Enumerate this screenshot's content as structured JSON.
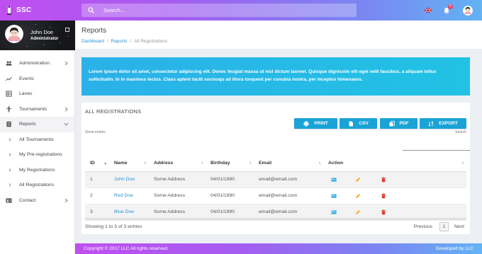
{
  "app": {
    "brand": "SSC"
  },
  "search": {
    "placeholder": "Search..."
  },
  "notifications": {
    "count": "5"
  },
  "user": {
    "name": "John Doe",
    "role": "Administrator"
  },
  "sidebar": {
    "items": [
      {
        "label": "Administration",
        "icon": "people-icon",
        "chevron": true
      },
      {
        "label": "Events",
        "icon": "trend-icon",
        "chevron": false
      },
      {
        "label": "Lanes",
        "icon": "table-icon",
        "chevron": false
      },
      {
        "label": "Tournaments",
        "icon": "person-icon",
        "chevron": true
      },
      {
        "label": "Reports",
        "icon": "report-icon",
        "chevron": true,
        "active": true
      },
      {
        "label": "All Tournaments",
        "sub": true
      },
      {
        "label": "My Pre-registrations",
        "sub": true
      },
      {
        "label": "My Registrations",
        "sub": true
      },
      {
        "label": "All Registrations",
        "sub": true
      },
      {
        "label": "Contact",
        "icon": "contact-icon",
        "chevron": true
      }
    ]
  },
  "page": {
    "title": "Reports",
    "breadcrumb": [
      "Dashboard",
      "Reports",
      "All Registrations"
    ]
  },
  "banner": {
    "text": "Lorem ipsum dolor sit amet, consectetur adipiscing elit. Donec feugiat massa ut nisl dictum laoreet. Quisque dignissim elit eget velit faucibus, a aliquam tellus sollicitudin. In in maximus lectus. Class aptent taciti sociosqu ad litora torquent per conubia nostra, per inceptos himenaeos."
  },
  "card": {
    "title": "ALL REGISTRATIONS",
    "buttons": {
      "print": "PRINT",
      "csv": "CSV",
      "pdf": "PDF",
      "export": "EXPORT"
    },
    "show_entries": "Show entries",
    "search_label": "Search"
  },
  "table": {
    "columns": [
      "ID",
      "Name",
      "Address",
      "Birthday",
      "Email",
      "Action"
    ],
    "rows": [
      {
        "id": "1",
        "name": "John Doe",
        "address": "Some Address",
        "birthday": "04/01/1990",
        "email": "email@email.com"
      },
      {
        "id": "2",
        "name": "Red Doe",
        "address": "Some Address",
        "birthday": "04/01/1990",
        "email": "email@email.com"
      },
      {
        "id": "3",
        "name": "Blue Doe",
        "address": "Some Address",
        "birthday": "04/01/1990",
        "email": "email@email.com"
      }
    ],
    "info": "Showing 1 to 3 of 3 entries",
    "pager": {
      "previous": "Previous",
      "current": "1",
      "next": "Next"
    }
  },
  "footer": {
    "left": "Copyright © 2017 LLC All rights reserved.",
    "right": "Developed by LLC"
  },
  "colors": {
    "accent": "#1aa3d6",
    "link": "#2a93d5",
    "banner": "#25b8e6",
    "delete": "#e53935",
    "edit": "#f5a623"
  }
}
